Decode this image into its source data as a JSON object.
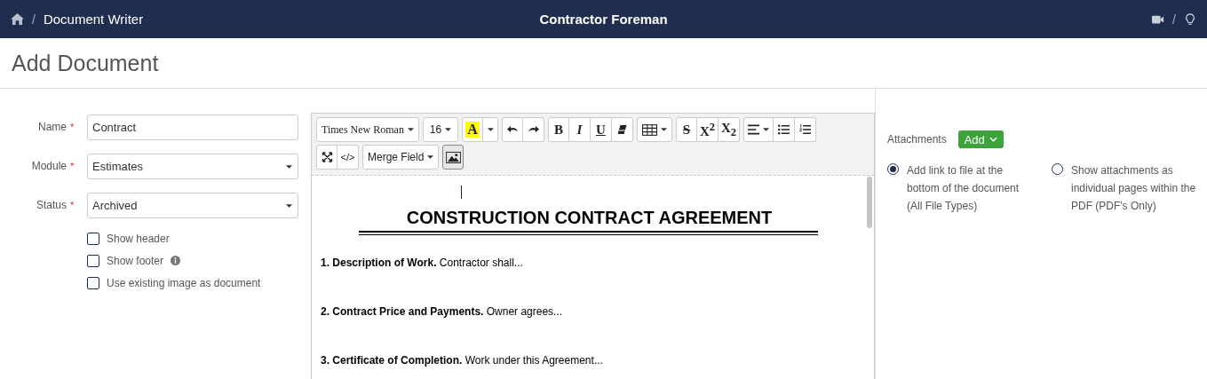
{
  "header": {
    "breadcrumb": "Document Writer",
    "separator": "/",
    "title": "Contractor Foreman",
    "right_separator": "/"
  },
  "page_title": "Add Document",
  "form": {
    "fields": [
      {
        "label": "Name",
        "required_mark": "*",
        "kind": "text",
        "value": "Contract"
      },
      {
        "label": "Module",
        "required_mark": "*",
        "kind": "select",
        "value": "Estimates"
      },
      {
        "label": "Status",
        "required_mark": "*",
        "kind": "select",
        "value": "Archived"
      }
    ],
    "checkboxes": [
      {
        "label": "Show header",
        "checked": false,
        "info": false
      },
      {
        "label": "Show footer",
        "checked": false,
        "info": true
      },
      {
        "label": "Use existing image as document",
        "checked": false,
        "info": false
      }
    ]
  },
  "toolbar": {
    "font": "Times New Roman",
    "size": "16",
    "color_letter": "A",
    "bold": "B",
    "italic": "I",
    "underline": "U",
    "strike": "S",
    "superscript": "X$^{2}$",
    "subscript": "X$_{2}$",
    "code_view": "</>",
    "merge_field": "Merge Field"
  },
  "document": {
    "title": "CONSTRUCTION CONTRACT AGREEMENT",
    "paragraphs": [
      "**1. Description of Work.** Contractor shall...",
      "**2. Contract Price and Payments.** Owner agrees...",
      "**3. Certificate of Completion.** Work under this Agreement..."
    ]
  },
  "attachments": {
    "label": "Attachments",
    "add_button": "Add",
    "options": [
      {
        "label": "Add link to file at the bottom of the document (All File Types)",
        "selected": true
      },
      {
        "label": "Show attachments as individual pages within the PDF (PDF's Only)",
        "selected": false
      }
    ]
  }
}
